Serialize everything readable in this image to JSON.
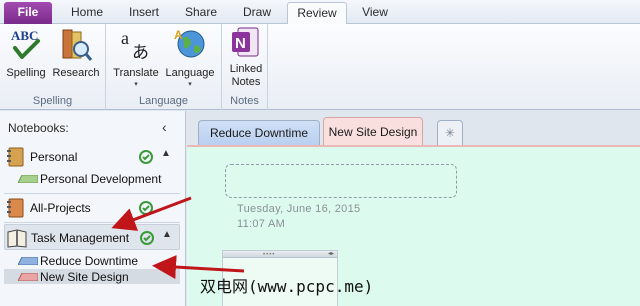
{
  "menu": {
    "tabs": [
      {
        "label": "File"
      },
      {
        "label": "Home"
      },
      {
        "label": "Insert"
      },
      {
        "label": "Share"
      },
      {
        "label": "Draw"
      },
      {
        "label": "Review"
      },
      {
        "label": "View"
      }
    ],
    "active_tab": "Review"
  },
  "ribbon": {
    "groups": [
      {
        "label": "Spelling",
        "buttons": [
          {
            "label": "Spelling",
            "icon": "spelling-abc-icon"
          },
          {
            "label": "Research",
            "icon": "research-books-icon"
          }
        ]
      },
      {
        "label": "Language",
        "buttons": [
          {
            "label": "Translate",
            "icon": "translate-icon"
          },
          {
            "label": "Language",
            "icon": "language-globe-icon"
          }
        ]
      },
      {
        "label": "Notes",
        "buttons": [
          {
            "label_line1": "Linked",
            "label_line2": "Notes",
            "icon": "onenote-linked-notes-icon"
          }
        ]
      }
    ]
  },
  "notebook_pane": {
    "title": "Notebooks:",
    "notebooks": [
      {
        "name": "Personal",
        "sections": [
          {
            "name": "Personal Development",
            "color": "#a8d08d"
          }
        ]
      },
      {
        "name": "All-Projects",
        "sections": []
      },
      {
        "name": "Task Management",
        "sections": [
          {
            "name": "Reduce Downtime",
            "color": "#8fb1e0"
          },
          {
            "name": "New Site Design",
            "color": "#e8a5a3"
          }
        ]
      }
    ]
  },
  "section_tabs": {
    "tabs": [
      {
        "label": "Reduce Downtime"
      },
      {
        "label": "New Site Design"
      }
    ],
    "add_tab_symbol": "✳",
    "active": "New Site Design"
  },
  "page": {
    "date": "Tuesday, June 16, 2015",
    "time": "11:07 AM",
    "note_handle_dots": "••••",
    "note_handle_arrow": "◂▸"
  },
  "colors": {
    "file_tab": "#8a349c",
    "annotation_arrow": "#c0161a",
    "page_background": "#dcfbee"
  },
  "watermark": "双电网(www.pcpc.me)"
}
